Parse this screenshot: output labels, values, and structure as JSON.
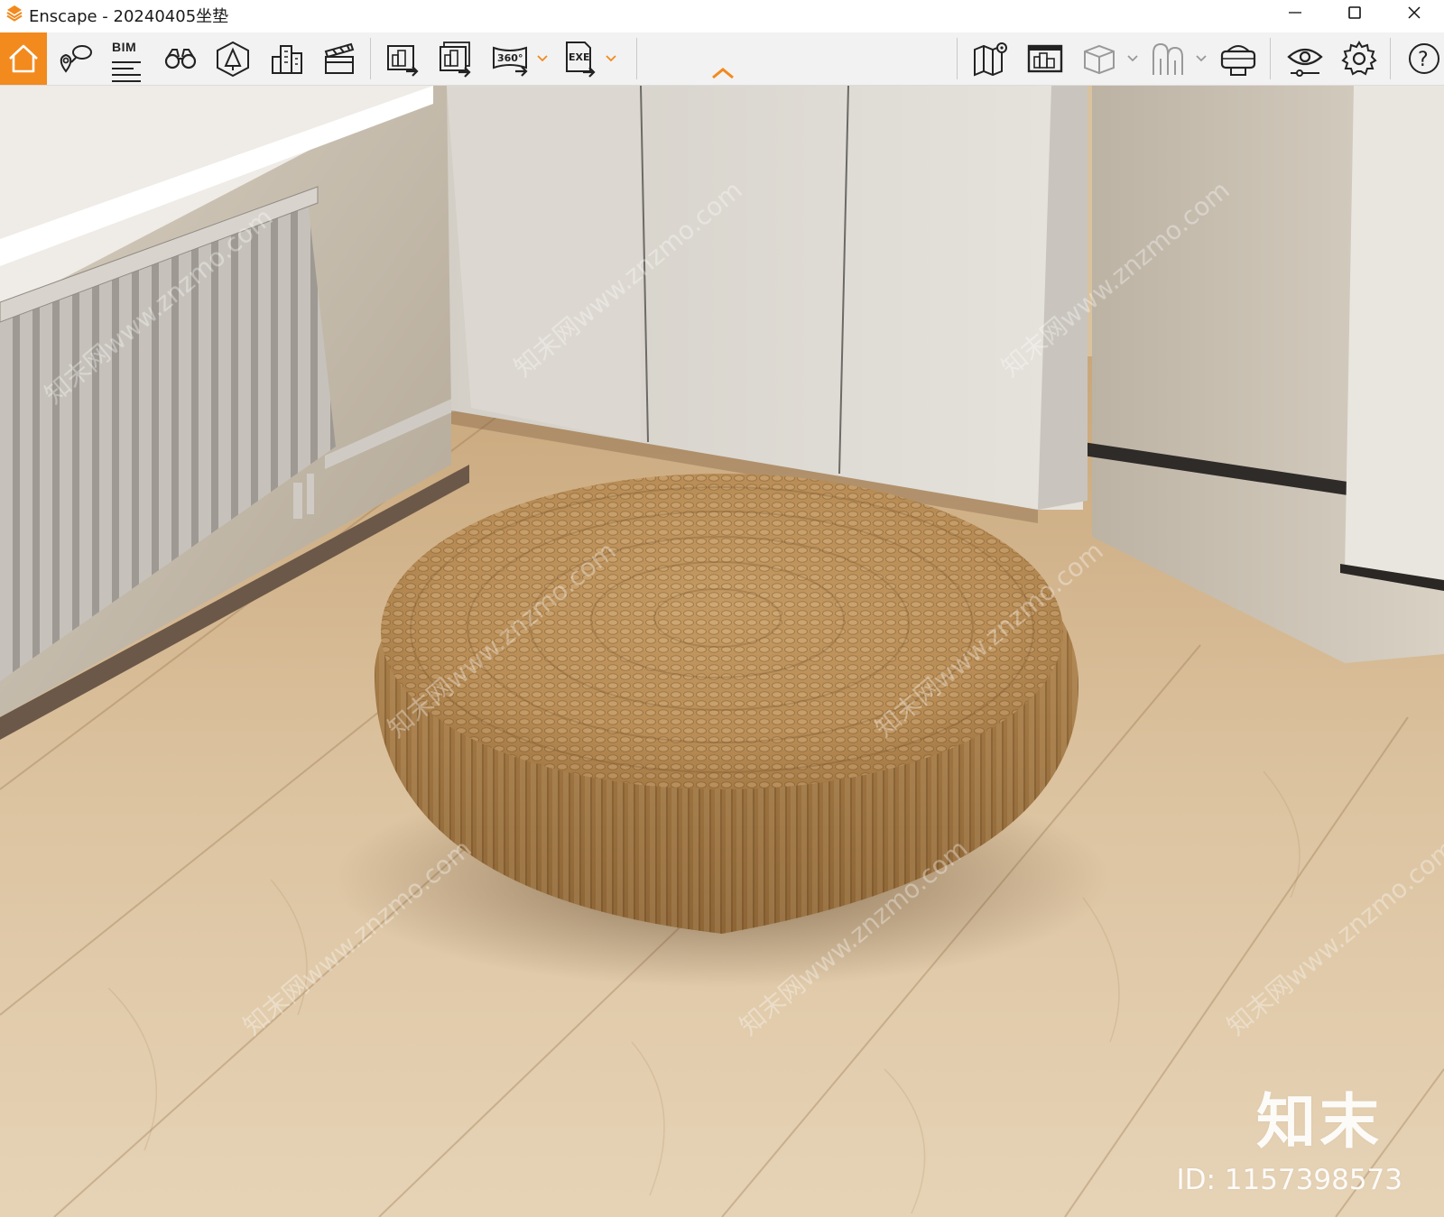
{
  "window": {
    "app_name": "Enscape",
    "title": "Enscape - 20240405坐垫",
    "accent_color": "#f28a1e",
    "controls": [
      "minimize-icon",
      "maximize-icon",
      "close-icon"
    ]
  },
  "toolbar": {
    "left_group": [
      {
        "name": "home-icon",
        "active": true
      },
      {
        "name": "view-management-icon"
      },
      {
        "name": "bim-icon",
        "label": "BIM"
      },
      {
        "name": "binoculars-icon"
      },
      {
        "name": "asset-library-icon"
      },
      {
        "name": "site-context-icon"
      },
      {
        "name": "video-editor-icon"
      }
    ],
    "export_group": [
      {
        "name": "render-image-icon"
      },
      {
        "name": "batch-render-icon"
      },
      {
        "name": "export-360-icon",
        "label": "360°",
        "dropdown": true
      },
      {
        "name": "export-exe-icon",
        "label": "EXE",
        "dropdown": true
      }
    ],
    "right_group": [
      {
        "name": "map-icon"
      },
      {
        "name": "mini-map-icon"
      },
      {
        "name": "section-box-icon",
        "dropdown": true
      },
      {
        "name": "walkthrough-icon",
        "dropdown": true
      },
      {
        "name": "vr-headset-icon"
      },
      {
        "name": "visual-settings-icon"
      },
      {
        "name": "settings-gear-icon"
      },
      {
        "name": "help-icon",
        "label": "?"
      }
    ]
  },
  "viewport": {
    "watermark_logo": "知末",
    "watermark_id": "ID: 1157398573",
    "diagonal_watermark": "知末网www.znzmo.com"
  }
}
